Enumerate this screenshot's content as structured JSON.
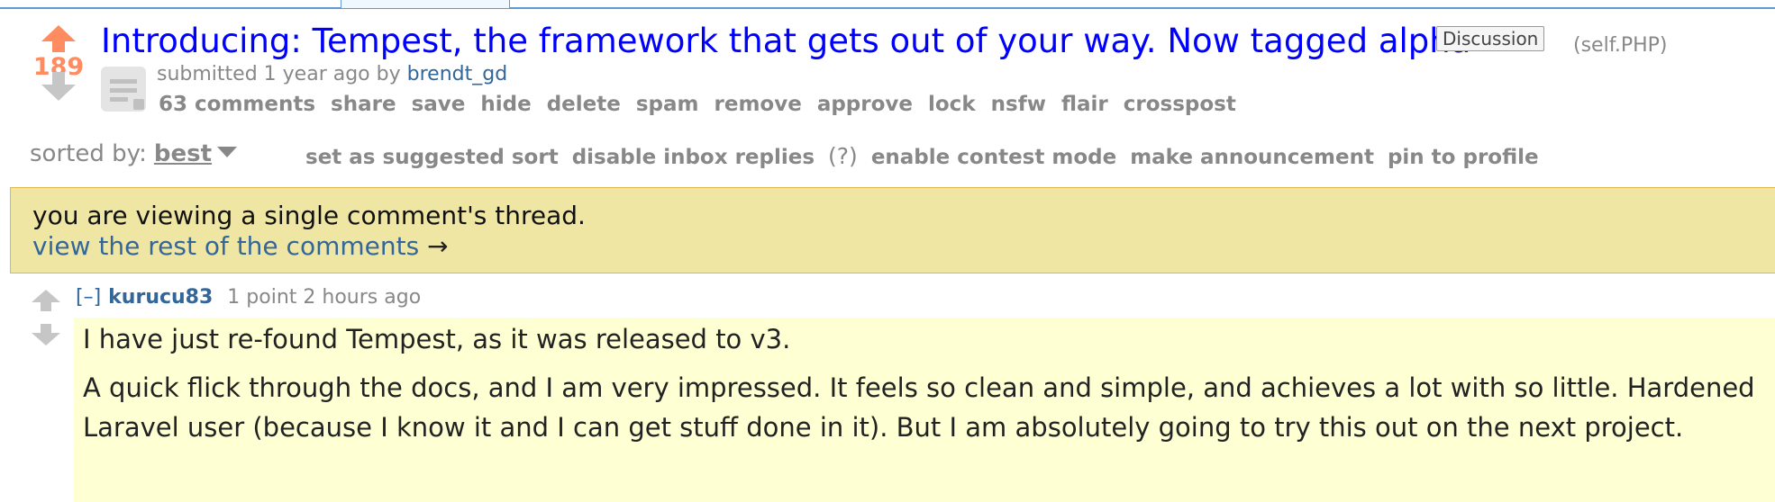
{
  "post": {
    "score": "189",
    "title": "Introducing: Tempest, the framework that gets out of your way. Now tagged alpha",
    "flair": "Discussion",
    "domain": "(self.PHP)",
    "submitted_prefix": "submitted",
    "time_ago": "1 year ago",
    "by_text": "by",
    "author": "brendt_gd",
    "buttons": [
      "63 comments",
      "share",
      "save",
      "hide",
      "delete",
      "spam",
      "remove",
      "approve",
      "lock",
      "nsfw",
      "flair",
      "crosspost"
    ]
  },
  "sort": {
    "label": "sorted by:",
    "value": "best",
    "links": [
      "set as suggested sort",
      "disable inbox replies",
      "(?)",
      "enable contest mode",
      "make announcement",
      "pin to profile"
    ]
  },
  "infobar": {
    "message": "you are viewing a single comment's thread.",
    "link": "view the rest of the comments",
    "arrow": "→"
  },
  "comment": {
    "toggle": "[–]",
    "author": "kurucu83",
    "points": "1 point",
    "time_ago": "2 hours ago",
    "paragraphs": [
      "I have just re-found Tempest, as it was released to v3.",
      "A quick flick through the docs, and I am very impressed. It feels so clean and simple, and achieves a lot with so little. Hardened Laravel user (because I know it and I can get stuff done in it). But I am absolutely going to try this out on the next project."
    ]
  },
  "colors": {
    "upvote": "#ff8b60",
    "link": "#369",
    "title": "#0000ff",
    "infobar_bg": "#f0e6a4",
    "comment_bg": "#ffffd4"
  }
}
